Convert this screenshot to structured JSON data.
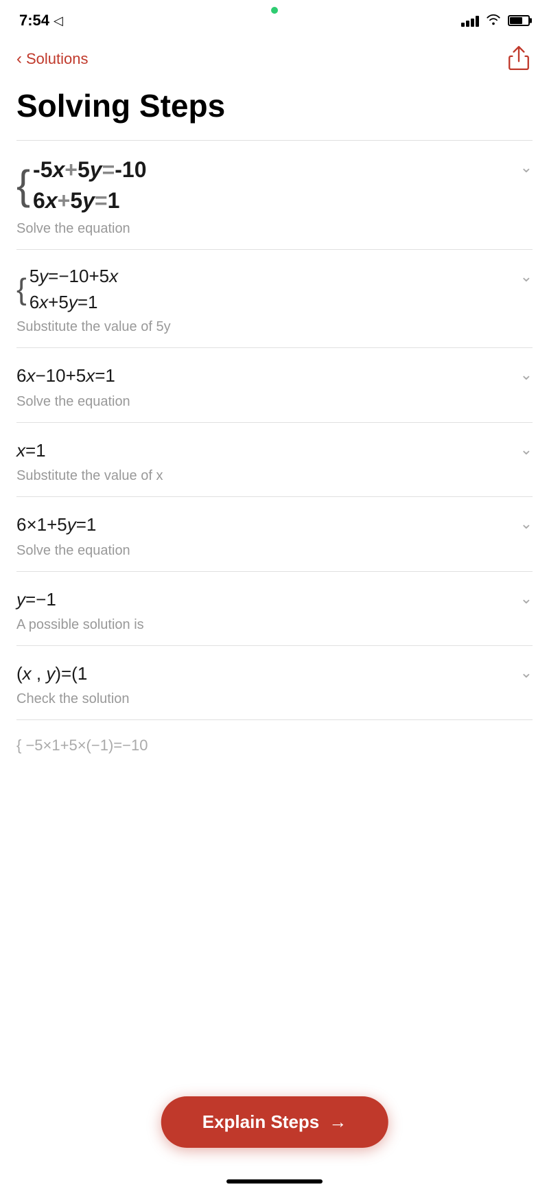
{
  "statusBar": {
    "time": "7:54",
    "locationIcon": "◁"
  },
  "nav": {
    "backLabel": "Solutions",
    "shareLabel": "share"
  },
  "page": {
    "title": "Solving Steps"
  },
  "steps": [
    {
      "id": 1,
      "type": "system",
      "equations": [
        "-5x+5y=-10",
        "6x+5y=1"
      ],
      "description": "Solve the equation",
      "large": true
    },
    {
      "id": 2,
      "type": "system",
      "equations": [
        "5y=-10+5x",
        "6x+5y=1"
      ],
      "description": "Substitute the value of 5y",
      "large": false
    },
    {
      "id": 3,
      "type": "single",
      "equation": "6x-10+5x=1",
      "description": "Solve the equation",
      "large": false
    },
    {
      "id": 4,
      "type": "single",
      "equation": "x=1",
      "description": "Substitute the value of x",
      "large": false
    },
    {
      "id": 5,
      "type": "single",
      "equation": "6×1+5y=1",
      "description": "Solve the equation",
      "large": false
    },
    {
      "id": 6,
      "type": "single",
      "equation": "y=-1",
      "description": "A possible solution is",
      "large": false
    },
    {
      "id": 7,
      "type": "single",
      "equation": "(x , y)=(1",
      "description": "Check the solution",
      "large": false,
      "partial": true
    }
  ],
  "explainBtn": {
    "label": "Explain Steps",
    "arrow": "→"
  }
}
